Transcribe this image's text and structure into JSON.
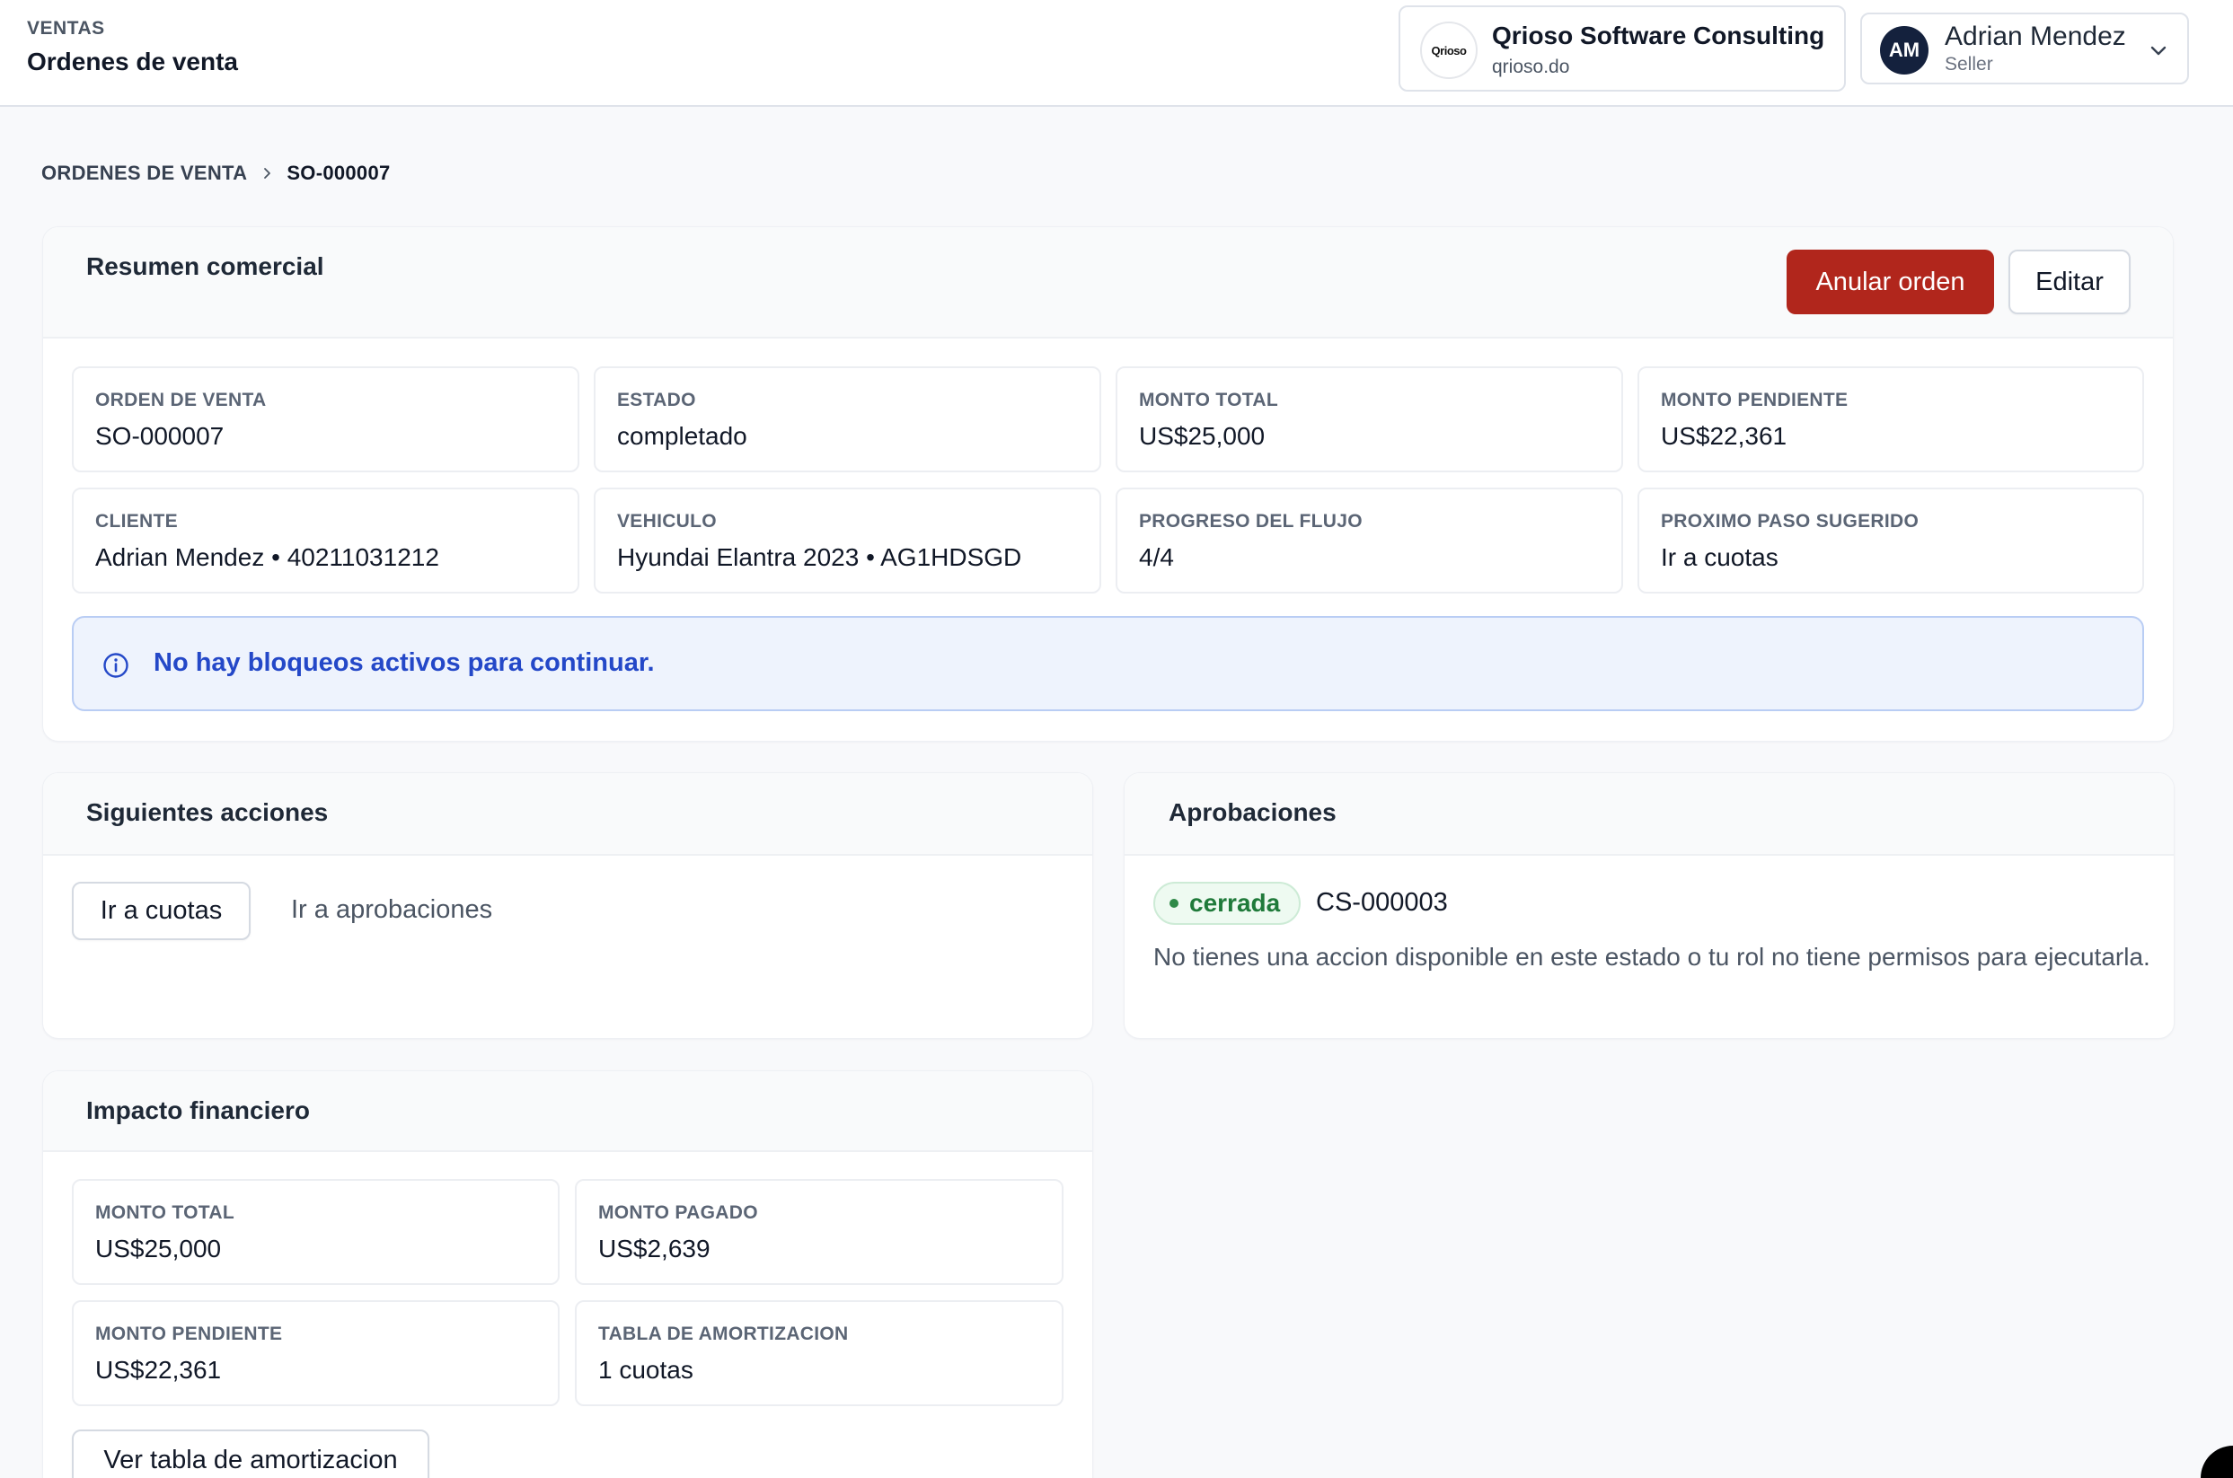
{
  "header": {
    "section": "VENTAS",
    "title": "Ordenes de venta",
    "org": {
      "logo_text": "Qrioso",
      "name": "Qrioso Software Consulting",
      "domain": "qrioso.do"
    },
    "user": {
      "initials": "AM",
      "name": "Adrian Mendez",
      "role": "Seller"
    }
  },
  "breadcrumb": {
    "parent": "ORDENES DE VENTA",
    "current": "SO-000007"
  },
  "summary": {
    "title": "Resumen comercial",
    "void_button": "Anular orden",
    "edit_button": "Editar",
    "fields": [
      {
        "label": "ORDEN DE VENTA",
        "value": "SO-000007"
      },
      {
        "label": "ESTADO",
        "value": "completado"
      },
      {
        "label": "MONTO TOTAL",
        "value": "US$25,000"
      },
      {
        "label": "MONTO PENDIENTE",
        "value": "US$22,361"
      },
      {
        "label": "CLIENTE",
        "value": "Adrian Mendez • 40211031212"
      },
      {
        "label": "VEHICULO",
        "value": "Hyundai Elantra 2023 • AG1HDSGD"
      },
      {
        "label": "PROGRESO DEL FLUJO",
        "value": "4/4"
      },
      {
        "label": "PROXIMO PASO SUGERIDO",
        "value": "Ir a cuotas"
      }
    ],
    "notice": "No hay bloqueos activos para continuar."
  },
  "next_actions": {
    "title": "Siguientes acciones",
    "primary": "Ir a cuotas",
    "secondary": "Ir a aprobaciones"
  },
  "approvals": {
    "title": "Aprobaciones",
    "status": "cerrada",
    "id": "CS-000003",
    "message": "No tienes una accion disponible en este estado o tu rol no tiene permisos para ejecutarla."
  },
  "financial": {
    "title": "Impacto financiero",
    "fields": [
      {
        "label": "MONTO TOTAL",
        "value": "US$25,000"
      },
      {
        "label": "MONTO PAGADO",
        "value": "US$2,639"
      },
      {
        "label": "MONTO PENDIENTE",
        "value": "US$22,361"
      },
      {
        "label": "TABLA DE AMORTIZACION",
        "value": "1 cuotas"
      }
    ],
    "button": "Ver tabla de amortizacion"
  }
}
